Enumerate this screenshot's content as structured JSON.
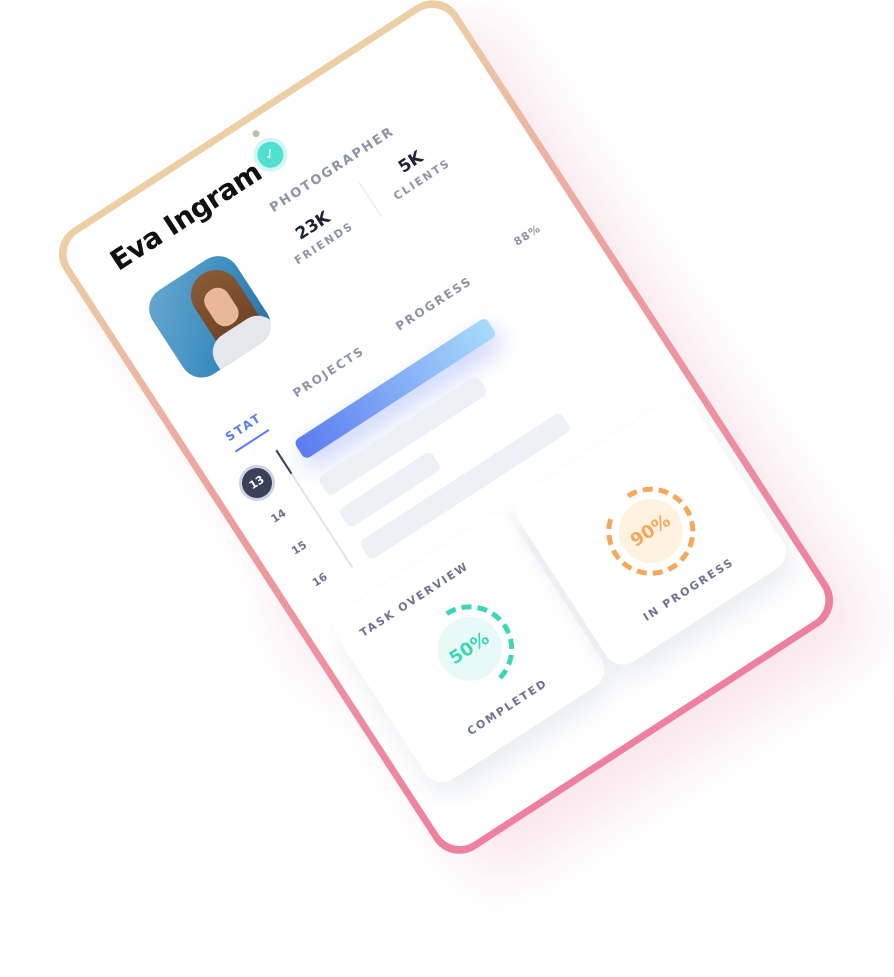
{
  "profile": {
    "name": "Eva Ingram",
    "role": "PHOTOGRAPHER",
    "friends": {
      "value": "23K",
      "label": "FRIENDS"
    },
    "clients": {
      "value": "5K",
      "label": "CLIENTS"
    }
  },
  "tabs": [
    {
      "label": "STAT",
      "active": true
    },
    {
      "label": "PROJECTS",
      "active": false
    },
    {
      "label": "PROGRESS",
      "active": false
    }
  ],
  "progress": {
    "percent_label": "88%",
    "value": 0.88
  },
  "days": [
    "13",
    "14",
    "15",
    "16"
  ],
  "cards": {
    "task_overview_title": "TASK OVERVIEW",
    "completed": {
      "pct": "50%",
      "label": "COMPLETED",
      "value": 0.5,
      "color": "#3dd6b8",
      "fill": "#e8faf6"
    },
    "in_progress": {
      "pct": "90%",
      "label": "IN PROGRESS",
      "value": 0.9,
      "color": "#f5a85b",
      "fill": "#fff2e0"
    }
  },
  "colors": {
    "accent": "#5b7bf0",
    "verified": "#4fe0cf"
  },
  "icons": {
    "verified": "check-icon",
    "avatar": "user-photo"
  }
}
